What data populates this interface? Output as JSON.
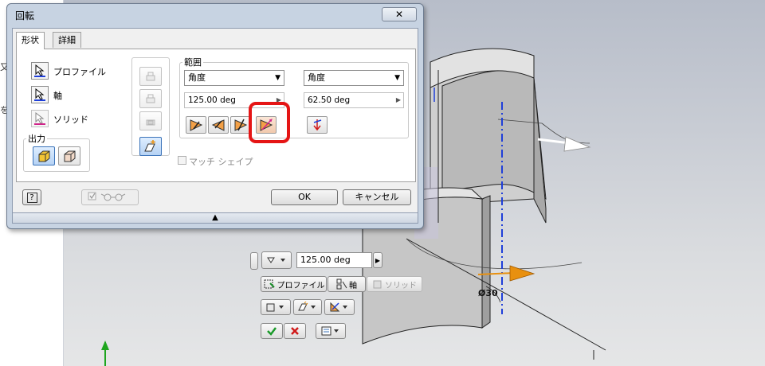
{
  "dialog": {
    "title": "回転",
    "close_symbol": "✕",
    "tabs": [
      {
        "label": "形状"
      },
      {
        "label": "詳細"
      }
    ],
    "selections": {
      "profile_label": "プロファイル",
      "axis_label": "軸",
      "solid_label": "ソリッド"
    },
    "output_label": "出力",
    "extents": {
      "group_label": "範囲",
      "left_type": "角度",
      "right_type": "角度",
      "left_value": "125.00 deg",
      "right_value": "62.50 deg"
    },
    "match_shape_label": "マッチ シェイプ",
    "help_label": "?",
    "ok_label": "OK",
    "cancel_label": "キャンセル",
    "collapse_symbol": "▲"
  },
  "left_strip": {
    "frag1": "又",
    "frag2": "を"
  },
  "mini_toolbar": {
    "value": "125.00 deg",
    "profile_label": "プロファイル",
    "axis_label": "軸",
    "solid_label": "ソリッド"
  },
  "viewport": {
    "dimension_label": "Ø30"
  },
  "colors": {
    "highlight": "#e51515",
    "dialog_frame": "#c7d3e2",
    "axis_line": "#1f3fd9",
    "arrow_orange": "#e8900f"
  }
}
